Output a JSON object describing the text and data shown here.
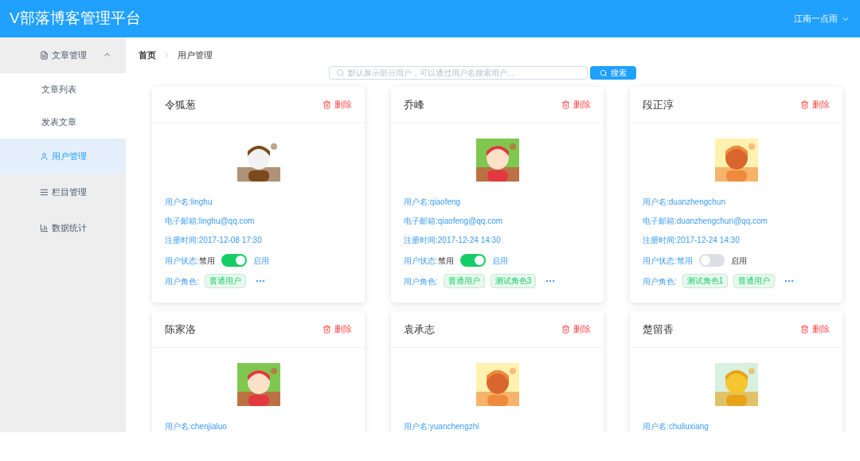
{
  "header": {
    "title": "V部落博客管理平台",
    "user": "江南一点雨"
  },
  "sidebar": {
    "items": [
      {
        "label": "文章管理",
        "selected": false,
        "expanded": true,
        "children": [
          {
            "label": "文章列表",
            "selected": false
          },
          {
            "label": "发表文章",
            "selected": false
          }
        ]
      },
      {
        "label": "用户管理",
        "selected": true
      },
      {
        "label": "栏目管理",
        "selected": false
      },
      {
        "label": "数据统计",
        "selected": false
      }
    ]
  },
  "breadcrumb": [
    "首页",
    "用户管理"
  ],
  "search": {
    "placeholder": "默认展示部分用户，可以通过用户名搜索用户...",
    "button": "搜索"
  },
  "users": [
    {
      "name": "令狐葱",
      "delete": "删除",
      "lines": [
        "用户名:linghu",
        "电子邮箱:linghu@qq.com",
        "注册时间:2017-12-08 17:30"
      ],
      "status": {
        "label": "用户状态:",
        "off_label": "禁用",
        "on_label": "启用",
        "on": true
      },
      "roles_label": "用户角色:",
      "roles": [
        "普通用户"
      ]
    },
    {
      "name": "乔峰",
      "delete": "删除",
      "lines": [
        "用户名:qiaofeng",
        "电子邮箱:qiaofeng@qq.com",
        "注册时间:2017-12-24 14:30"
      ],
      "status": {
        "label": "用户状态:",
        "off_label": "禁用",
        "on_label": "启用",
        "on": true
      },
      "roles_label": "用户角色:",
      "roles": [
        "普通用户",
        "测试角色3"
      ]
    },
    {
      "name": "段正淳",
      "delete": "删除",
      "lines": [
        "用户名:duanzhengchun",
        "电子邮箱:duanzhengchun@qq.com",
        "注册时间:2017-12-24 14:30"
      ],
      "status": {
        "label": "用户状态:",
        "off_label": "禁用",
        "on_label": "启用",
        "on": false
      },
      "roles_label": "用户角色:",
      "roles": [
        "测试角色1",
        "普通用户"
      ]
    },
    {
      "name": "陈家洛",
      "delete": "删除",
      "lines": [
        "用户名:chenjialuo"
      ]
    },
    {
      "name": "袁承志",
      "delete": "删除",
      "lines": [
        "用户名:yuanchengzhi"
      ]
    },
    {
      "name": "楚留香",
      "delete": "删除",
      "lines": [
        "用户名:chuliuxiang"
      ]
    }
  ]
}
